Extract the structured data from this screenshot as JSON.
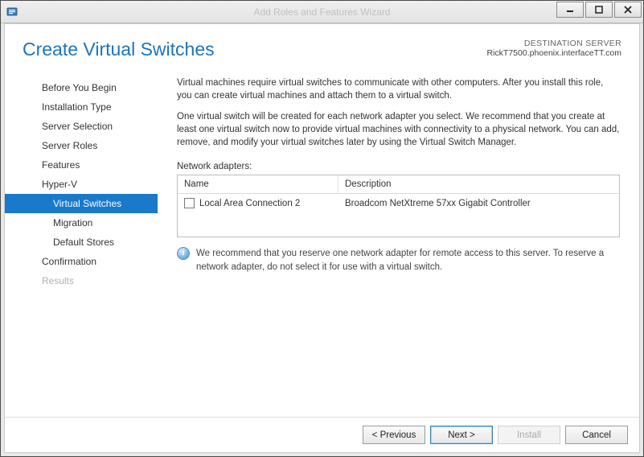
{
  "window": {
    "title": "Add Roles and Features Wizard"
  },
  "header": {
    "page_title": "Create Virtual Switches",
    "destination_label": "DESTINATION SERVER",
    "destination_value": "RickT7500.phoenix.interfaceTT.com"
  },
  "sidebar": {
    "items": [
      {
        "label": "Before You Begin"
      },
      {
        "label": "Installation Type"
      },
      {
        "label": "Server Selection"
      },
      {
        "label": "Server Roles"
      },
      {
        "label": "Features"
      },
      {
        "label": "Hyper-V"
      },
      {
        "label": "Virtual Switches",
        "selected": true,
        "sub": true
      },
      {
        "label": "Migration",
        "sub": true
      },
      {
        "label": "Default Stores",
        "sub": true
      },
      {
        "label": "Confirmation"
      },
      {
        "label": "Results",
        "disabled": true
      }
    ]
  },
  "main": {
    "para1": "Virtual machines require virtual switches to communicate with other computers. After you install this role, you can create virtual machines and attach them to a virtual switch.",
    "para2": "One virtual switch will be created for each network adapter you select. We recommend that you create at least one virtual switch now to provide virtual machines with connectivity to a physical network. You can add, remove, and modify your virtual switches later by using the Virtual Switch Manager.",
    "adapters_label": "Network adapters:",
    "columns": {
      "name": "Name",
      "description": "Description"
    },
    "rows": [
      {
        "name": "Local Area Connection 2",
        "description": "Broadcom NetXtreme 57xx Gigabit Controller",
        "checked": false
      }
    ],
    "info": "We recommend that you reserve one network adapter for remote access to this server. To reserve a network adapter, do not select it for use with a virtual switch."
  },
  "footer": {
    "previous": "< Previous",
    "next": "Next >",
    "install": "Install",
    "cancel": "Cancel"
  }
}
